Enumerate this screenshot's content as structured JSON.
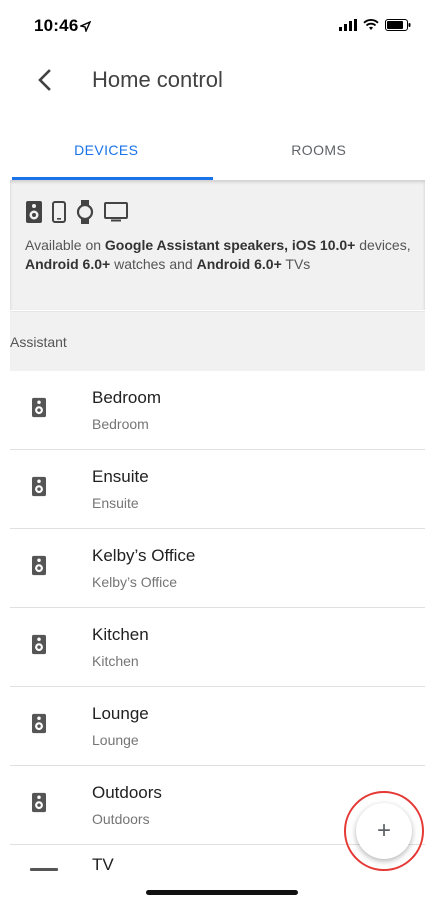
{
  "status_bar": {
    "time": "10:46",
    "icons": [
      "location-arrow-icon",
      "signal-icon",
      "wifi-icon",
      "battery-icon"
    ]
  },
  "app_bar": {
    "title": "Home control",
    "back_icon": "chevron-left-icon"
  },
  "tabs": [
    {
      "label": "DEVICES",
      "active": true
    },
    {
      "label": "ROOMS",
      "active": false
    }
  ],
  "banner": {
    "icons": [
      "speaker-icon",
      "phone-icon",
      "watch-icon",
      "tv-icon"
    ],
    "text_prefix": "Available on ",
    "text_bold_1": "Google Assistant speakers, iOS 10.0+",
    "text_mid_1": " devices, ",
    "text_bold_2": "Android 6.0+",
    "text_mid_2": " watches and ",
    "text_bold_3": "Android 6.0+",
    "text_suffix": " TVs"
  },
  "section": {
    "title": "Assistant"
  },
  "devices": [
    {
      "name": "Bedroom",
      "room": "Bedroom",
      "icon": "speaker-icon"
    },
    {
      "name": "Ensuite",
      "room": "Ensuite",
      "icon": "speaker-icon"
    },
    {
      "name": "Kelby’s Office",
      "room": "Kelby’s Office",
      "icon": "speaker-icon"
    },
    {
      "name": "Kitchen",
      "room": "Kitchen",
      "icon": "speaker-icon"
    },
    {
      "name": "Lounge",
      "room": "Lounge",
      "icon": "speaker-icon"
    },
    {
      "name": "Outdoors",
      "room": "Outdoors",
      "icon": "speaker-icon"
    },
    {
      "name": "TV",
      "room": "",
      "icon": "tv-icon"
    }
  ],
  "fab": {
    "label": "+",
    "icon": "plus-icon"
  },
  "colors": {
    "accent": "#1a73e8",
    "highlight_ring": "#e53935",
    "banner_bg": "#f1f1f1"
  }
}
